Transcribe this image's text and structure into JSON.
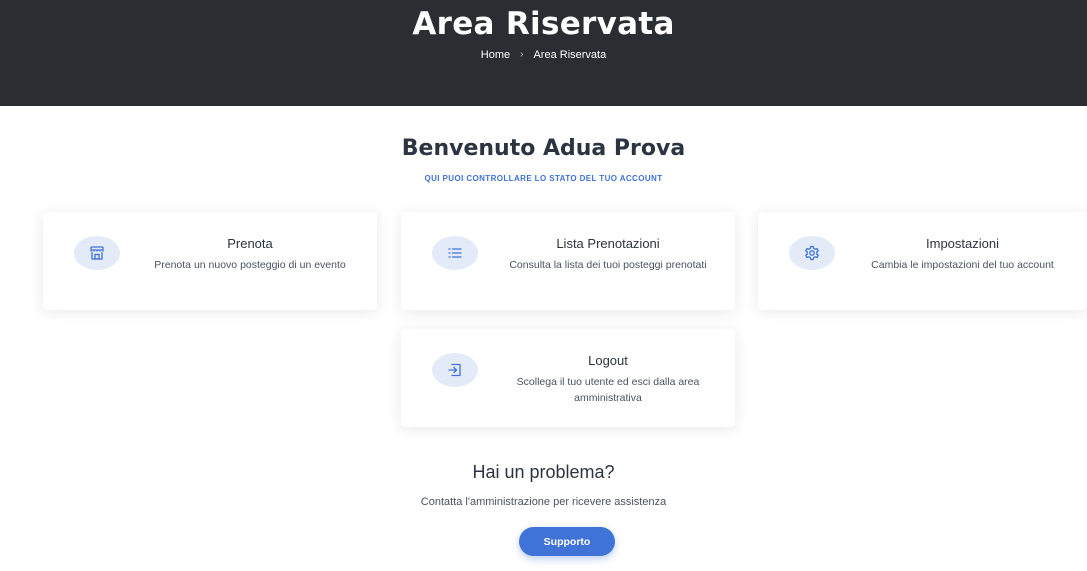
{
  "header": {
    "title": "Area Riservata",
    "breadcrumb": {
      "home": "Home",
      "separator": "›",
      "current": "Area Riservata"
    }
  },
  "welcome": {
    "title": "Benvenuto Adua Prova",
    "subtitle": "QUI PUOI CONTROLLARE LO STATO DEL TUO ACCOUNT"
  },
  "cards": [
    {
      "icon": "store-icon",
      "title": "Prenota",
      "description": "Prenota un nuovo posteggio di un evento"
    },
    {
      "icon": "list-icon",
      "title": "Lista Prenotazioni",
      "description": "Consulta la lista dei tuoi posteggi prenotati"
    },
    {
      "icon": "gear-icon",
      "title": "Impostazioni",
      "description": "Cambia le impostazioni del tuo account"
    },
    {
      "icon": "logout-icon",
      "title": "Logout",
      "description": "Scollega il tuo utente ed esci dalla area amministrativa"
    }
  ],
  "help": {
    "title": "Hai un problema?",
    "text": "Contatta l'amministrazione per ricevere assistenza",
    "button": "Supporto"
  },
  "colors": {
    "accent": "#3f73d8",
    "header_bg": "#2a2d32",
    "icon_bg": "#e4ebf8"
  }
}
